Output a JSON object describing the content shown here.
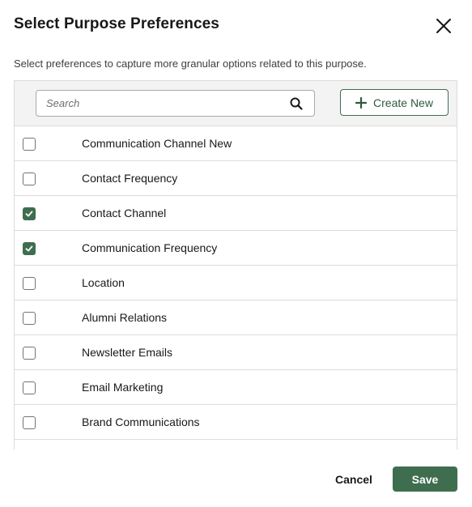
{
  "modal": {
    "title": "Select Purpose Preferences",
    "subtitle": "Select preferences to capture more granular options related to this purpose.",
    "close_icon": "close-icon"
  },
  "toolbar": {
    "search_placeholder": "Search",
    "search_value": "",
    "search_icon": "search-icon",
    "create_label": "Create New",
    "create_icon": "plus-icon"
  },
  "preferences": [
    {
      "label": "Communication Channel New",
      "checked": false
    },
    {
      "label": "Contact Frequency",
      "checked": false
    },
    {
      "label": "Contact Channel",
      "checked": true
    },
    {
      "label": "Communication Frequency",
      "checked": true
    },
    {
      "label": "Location",
      "checked": false
    },
    {
      "label": "Alumni Relations",
      "checked": false
    },
    {
      "label": "Newsletter Emails",
      "checked": false
    },
    {
      "label": "Email Marketing",
      "checked": false
    },
    {
      "label": "Brand Communications",
      "checked": false
    }
  ],
  "footer": {
    "cancel_label": "Cancel",
    "save_label": "Save"
  },
  "colors": {
    "brand": "#3f6e4f",
    "border": "#dddbda",
    "toolbar_bg": "#f3f3f3"
  }
}
